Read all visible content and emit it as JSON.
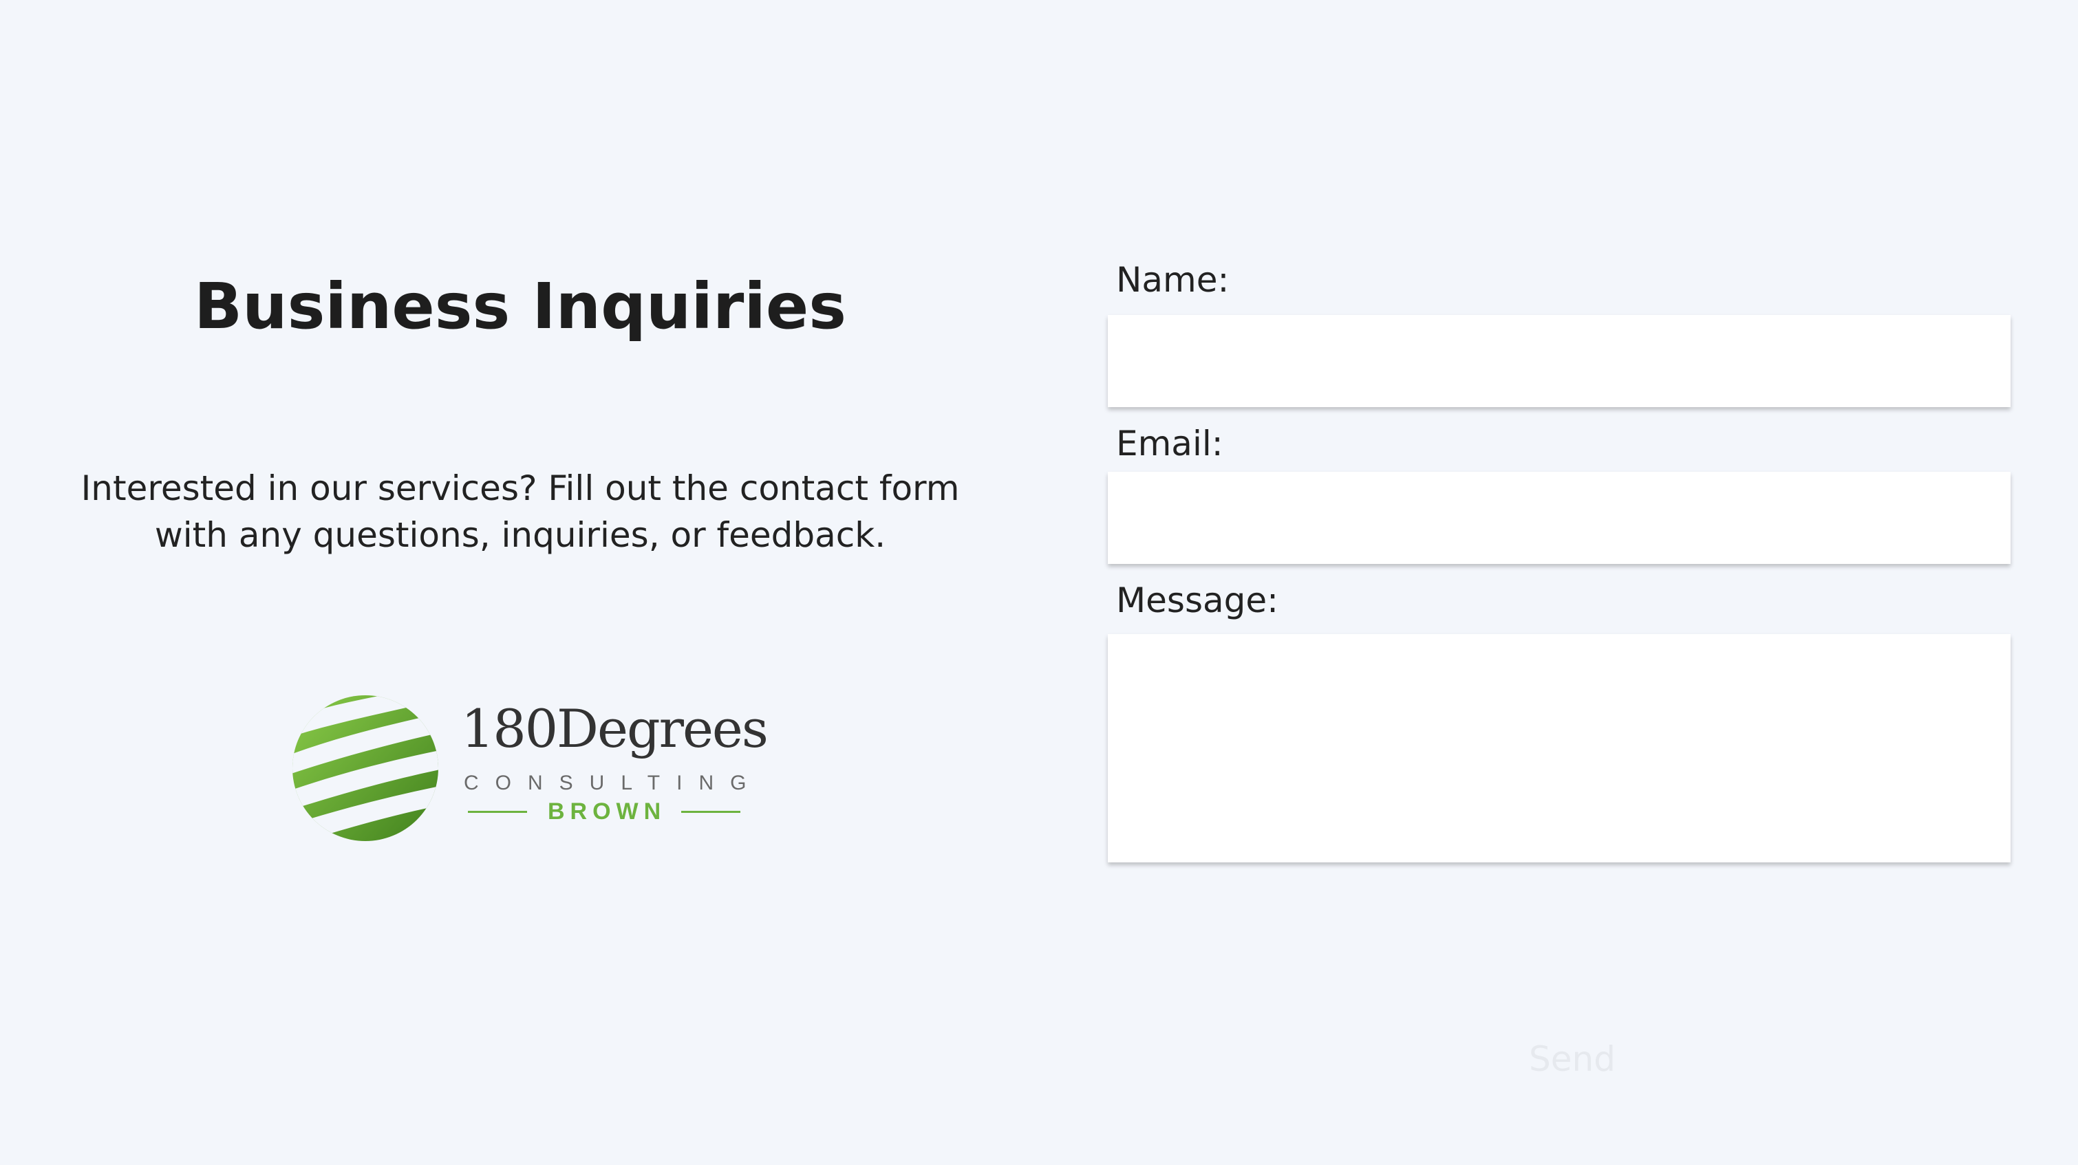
{
  "heading": "Business Inquiries",
  "intro": "Interested in our services? Fill out the contact form with any questions, inquiries, or feedback.",
  "logo": {
    "brand": "180Degrees",
    "subtitle": "CONSULTING",
    "chapter": "BROWN",
    "icon": "striped-green-globe",
    "colors": {
      "green": "#6db33f",
      "dark_green": "#4e8f24",
      "text": "#333333"
    }
  },
  "form": {
    "name_label": "Name:",
    "name_value": "",
    "email_label": "Email:",
    "email_value": "",
    "message_label": "Message:",
    "message_value": "",
    "send_label": "Send"
  },
  "colors": {
    "background": "#f3f6fb",
    "field": "#ffffff",
    "send_text": "#e6e9ee"
  }
}
